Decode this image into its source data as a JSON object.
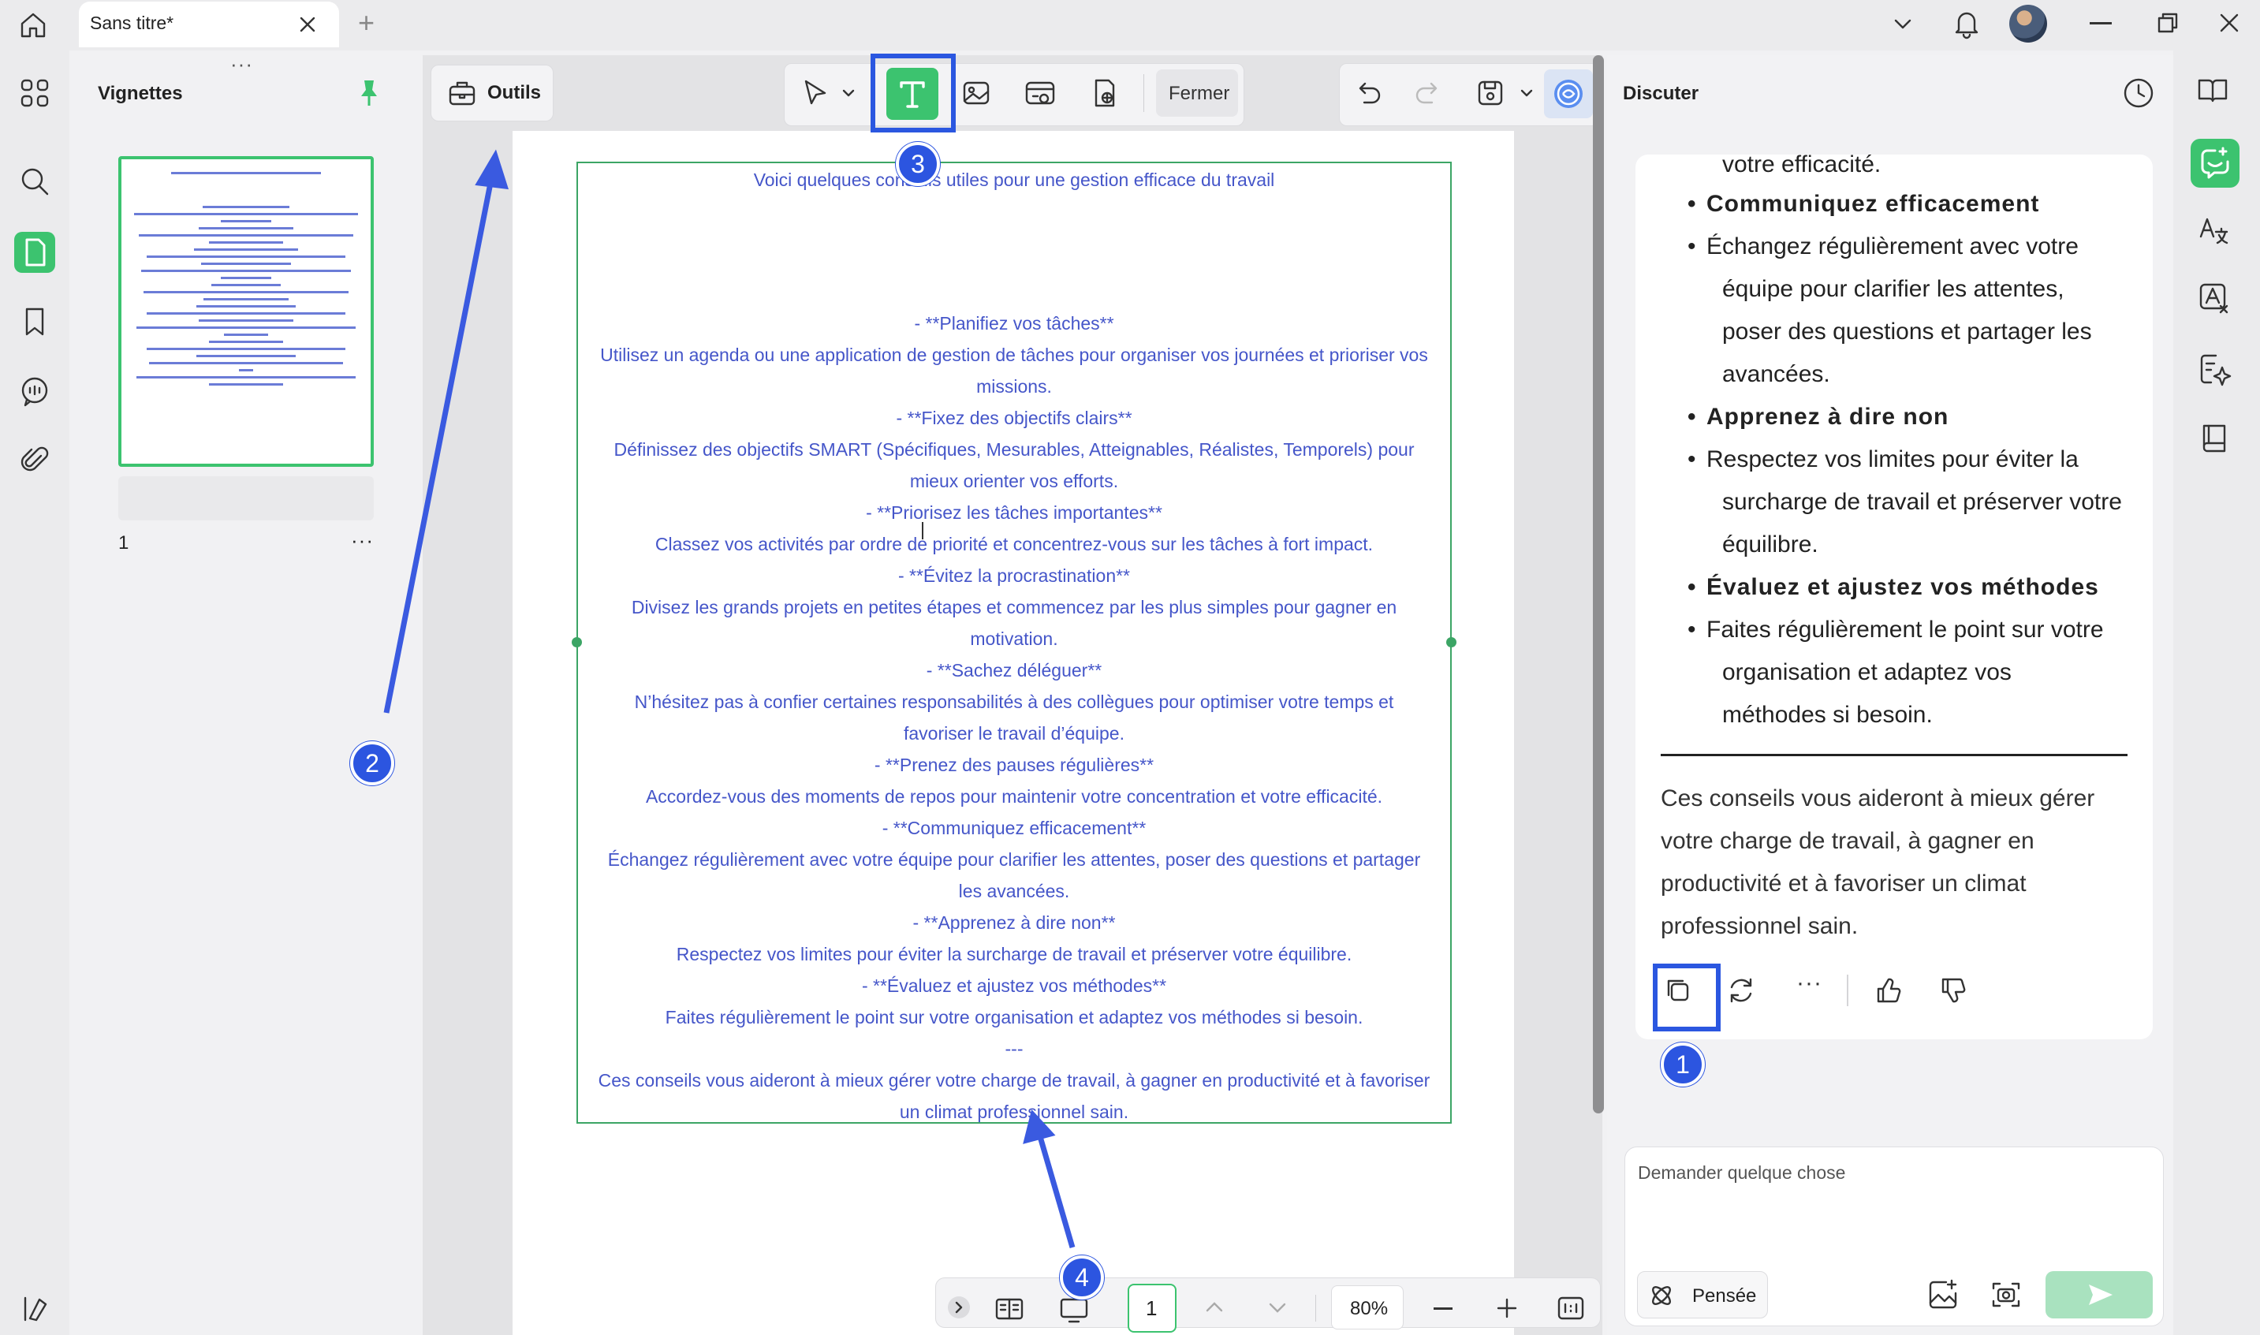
{
  "window": {
    "tab_title": "Sans titre*",
    "new_tab_symbol": "+",
    "avatar": "avatar"
  },
  "thumbnails": {
    "title": "Vignettes",
    "page_number": "1",
    "more": "···",
    "drag_handle": "···"
  },
  "toolbar": {
    "tools_label": "Outils",
    "close_label": "Fermer"
  },
  "document": {
    "lines": [
      "Voici quelques conseils utiles pour une gestion efficace du travail",
      "- **Planifiez vos tâches**",
      "Utilisez un agenda ou une application de gestion de tâches pour organiser vos journées et prioriser vos",
      "missions.",
      "- **Fixez des objectifs clairs**",
      "Définissez des objectifs SMART (Spécifiques, Mesurables, Atteignables, Réalistes, Temporels) pour",
      "mieux orienter vos efforts.",
      "- **Priorisez les tâches importantes**",
      "Classez vos activités par ordre de priorité et concentrez-vous sur les tâches à fort impact.",
      "- **Évitez la procrastination**",
      "Divisez les grands projets en petites étapes et commencez par les plus simples pour gagner en",
      "motivation.",
      "- **Sachez déléguer**",
      "N’hésitez pas à confier certaines responsabilités à des collègues pour optimiser votre temps et",
      "favoriser le travail d’équipe.",
      "- **Prenez des pauses régulières**",
      "Accordez-vous des moments de repos pour maintenir votre concentration et votre efficacité.",
      "- **Communiquez efficacement**",
      "Échangez régulièrement avec votre équipe pour clarifier les attentes, poser des questions et partager",
      "les avancées.",
      "- **Apprenez à dire non**",
      "Respectez vos limites pour éviter la surcharge de travail et préserver votre équilibre.",
      "- **Évaluez et ajustez vos méthodes**",
      "Faites régulièrement le point sur votre organisation et adaptez vos méthodes si besoin.",
      "---",
      "Ces conseils vous aideront à mieux gérer votre charge de travail, à gagner en productivité et à favoriser",
      "un climat professionnel sain."
    ]
  },
  "pagebar": {
    "page_input": "1",
    "zoom": "80%"
  },
  "chat": {
    "title": "Discuter",
    "partial_top": "votre efficacité.",
    "items": [
      {
        "type": "head",
        "text": "Communiquez efficacement"
      },
      {
        "type": "body",
        "lines": [
          "Échangez régulièrement avec votre",
          "équipe pour clarifier les attentes,",
          "poser des questions et partager les",
          "avancées."
        ]
      },
      {
        "type": "head",
        "text": "Apprenez à dire non"
      },
      {
        "type": "body",
        "lines": [
          "Respectez vos limites pour éviter la",
          "surcharge de travail et préserver votre",
          "équilibre."
        ]
      },
      {
        "type": "head",
        "text": "Évaluez et ajustez vos méthodes"
      },
      {
        "type": "body",
        "lines": [
          "Faites régulièrement le point sur votre",
          "organisation et adaptez vos",
          "méthodes si besoin."
        ]
      }
    ],
    "conclusion": [
      "Ces conseils vous aideront à mieux gérer",
      "votre charge de travail, à gagner en",
      "productivité et à favoriser un climat",
      "professionnel sain."
    ],
    "more": "···",
    "input_placeholder": "Demander quelque chose",
    "think_label": "Pensée"
  },
  "annotations": {
    "callout_1": "1",
    "callout_2": "2",
    "callout_3": "3",
    "callout_4": "4",
    "color": "#2c55e0"
  },
  "colors": {
    "accent_green": "#3cc36f",
    "doc_text": "#4556c9"
  }
}
